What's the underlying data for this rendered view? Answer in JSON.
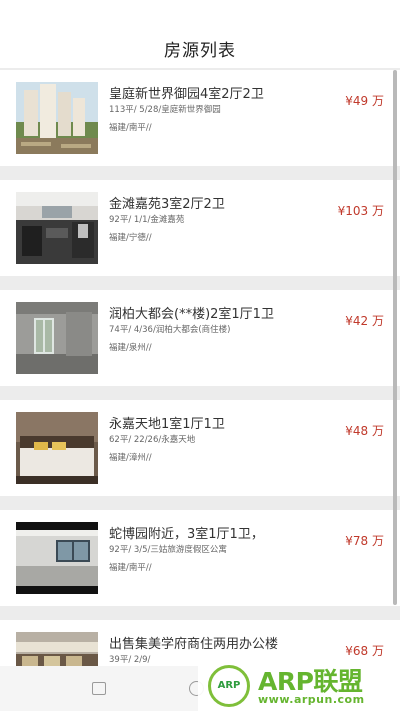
{
  "header": {
    "title": "房源列表"
  },
  "listings": [
    {
      "title": "皇庭新世界御园4室2厅2卫",
      "meta": "113平/ 5/28/皇庭新世界御园",
      "location": "福建/南平//",
      "price": "¥49 万",
      "thumb": "highrise-buildings"
    },
    {
      "title": "金滩嘉苑3室2厅2卫",
      "meta": "92平/ 1/1/金滩嘉苑",
      "location": "福建/宁德//",
      "price": "¥103 万",
      "thumb": "kitchen-interior"
    },
    {
      "title": "润柏大都会(**楼)2室1厅1卫",
      "meta": "74平/ 4/36/润柏大都会(商住楼)",
      "location": "福建/泉州//",
      "price": "¥42 万",
      "thumb": "empty-concrete-room"
    },
    {
      "title": "永嘉天地1室1厅1卫",
      "meta": "62平/ 22/26/永嘉天地",
      "location": "福建/漳州//",
      "price": "¥48 万",
      "thumb": "bedroom"
    },
    {
      "title": "蛇博园附近，3室1厅1卫，",
      "meta": "92平/ 3/5/三姑旅游度假区公寓",
      "location": "福建/南平//",
      "price": "¥78 万",
      "thumb": "empty-hall"
    },
    {
      "title": "出售集美学府商住两用办公楼",
      "meta": "39平/ 2/9/",
      "location": "",
      "price": "¥68 万",
      "thumb": "storefront-street"
    }
  ],
  "navbar": {
    "buttons": [
      "recent-apps",
      "home"
    ]
  },
  "watermark": {
    "badge": "ARP",
    "brand": "ARP联盟",
    "url": "www.arpun.com"
  },
  "colors": {
    "price": "#c0392b",
    "separator": "#ececec",
    "watermark": "#65b52f"
  }
}
